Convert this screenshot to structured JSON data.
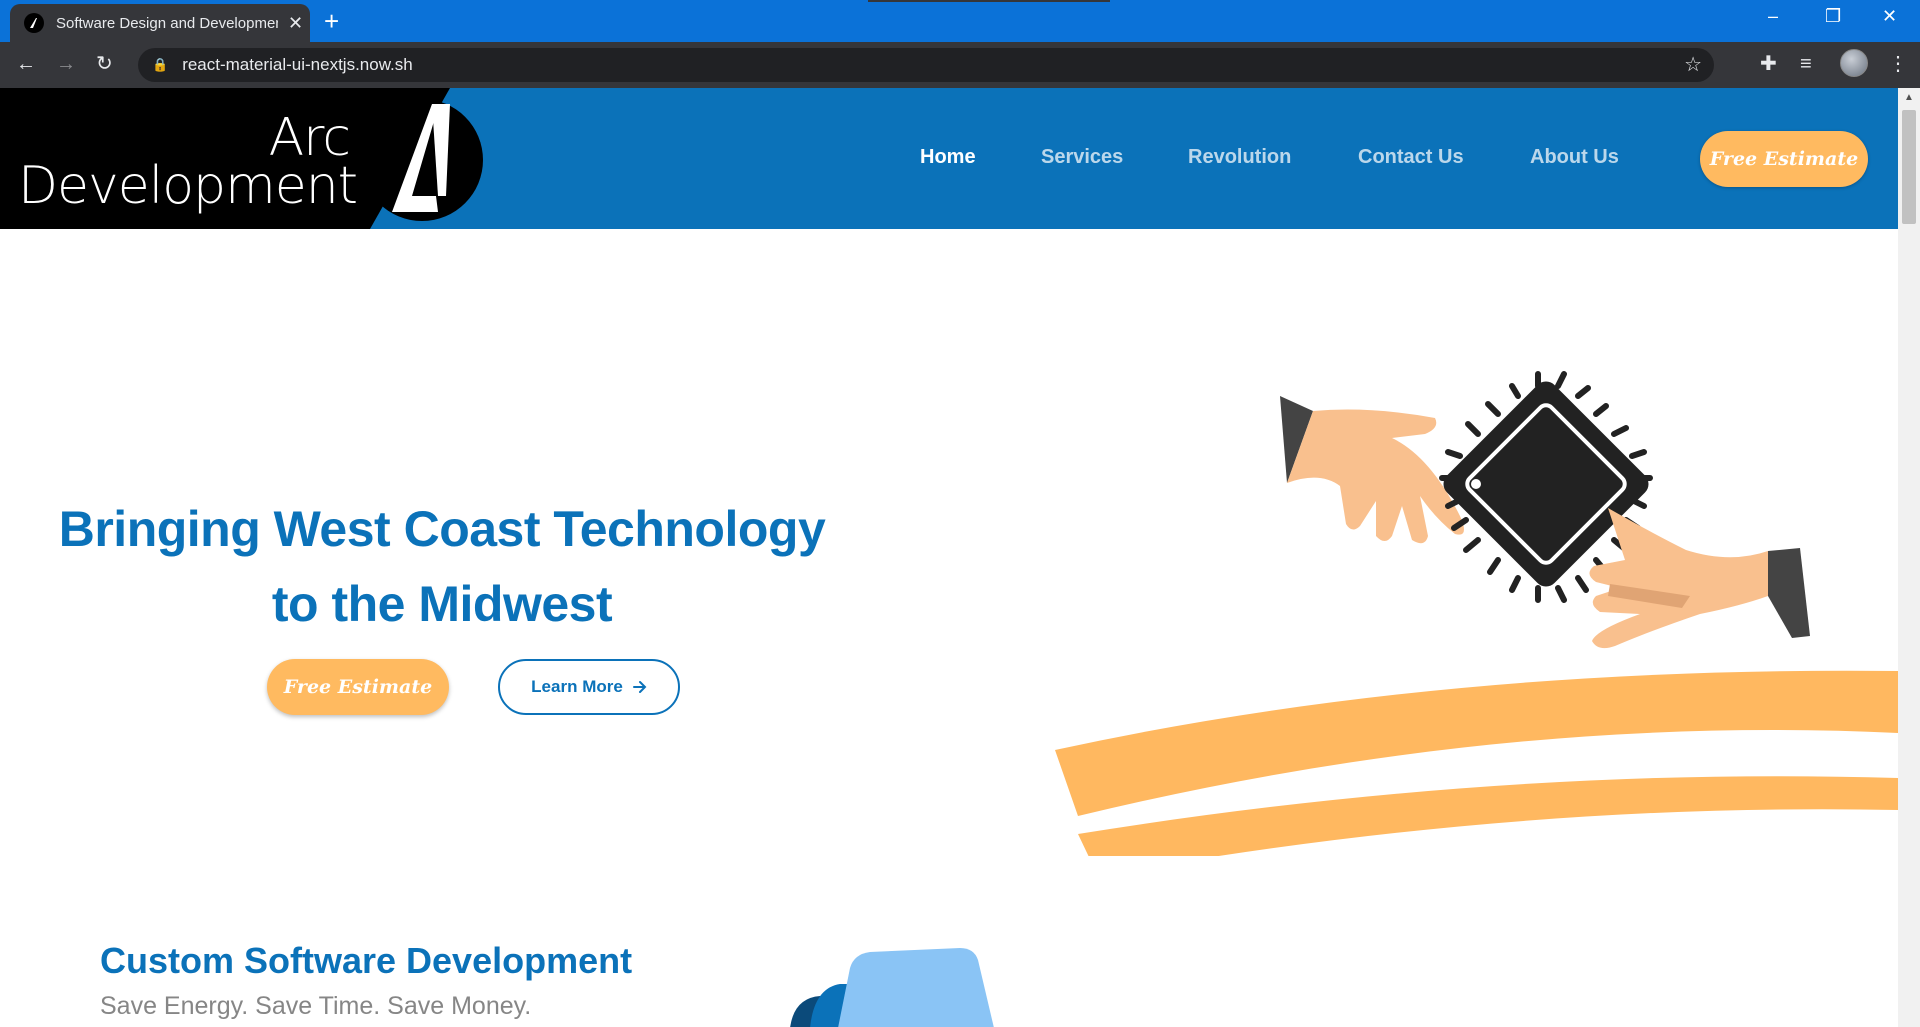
{
  "browser": {
    "tab_title": "Software Design and Development",
    "new_tab": "+",
    "url": "react-material-ui-nextjs.now.sh",
    "window_controls": {
      "minimize": "–",
      "restore": "❐",
      "close": "✕"
    }
  },
  "site": {
    "logo": {
      "line1": "Arc",
      "line2": "Development"
    },
    "nav": [
      {
        "label": "Home",
        "active": true
      },
      {
        "label": "Services",
        "active": false
      },
      {
        "label": "Revolution",
        "active": false
      },
      {
        "label": "Contact Us",
        "active": false
      },
      {
        "label": "About Us",
        "active": false
      }
    ],
    "estimate_button": "Free Estimate"
  },
  "hero": {
    "title_line1": "Bringing West Coast Technology",
    "title_line2": "to the Midwest",
    "estimate_button": "Free Estimate",
    "learn_more_button": "Learn More",
    "learn_more_icon": "arrow-right-icon"
  },
  "services": {
    "title": "Custom Software Development",
    "subtitle": "Save Energy. Save Time. Save Money."
  },
  "colors": {
    "blue": "#0b72b9",
    "orange": "#ffba60",
    "chrome_dark": "#35363a",
    "titlebar_blue": "#0b72d8"
  }
}
